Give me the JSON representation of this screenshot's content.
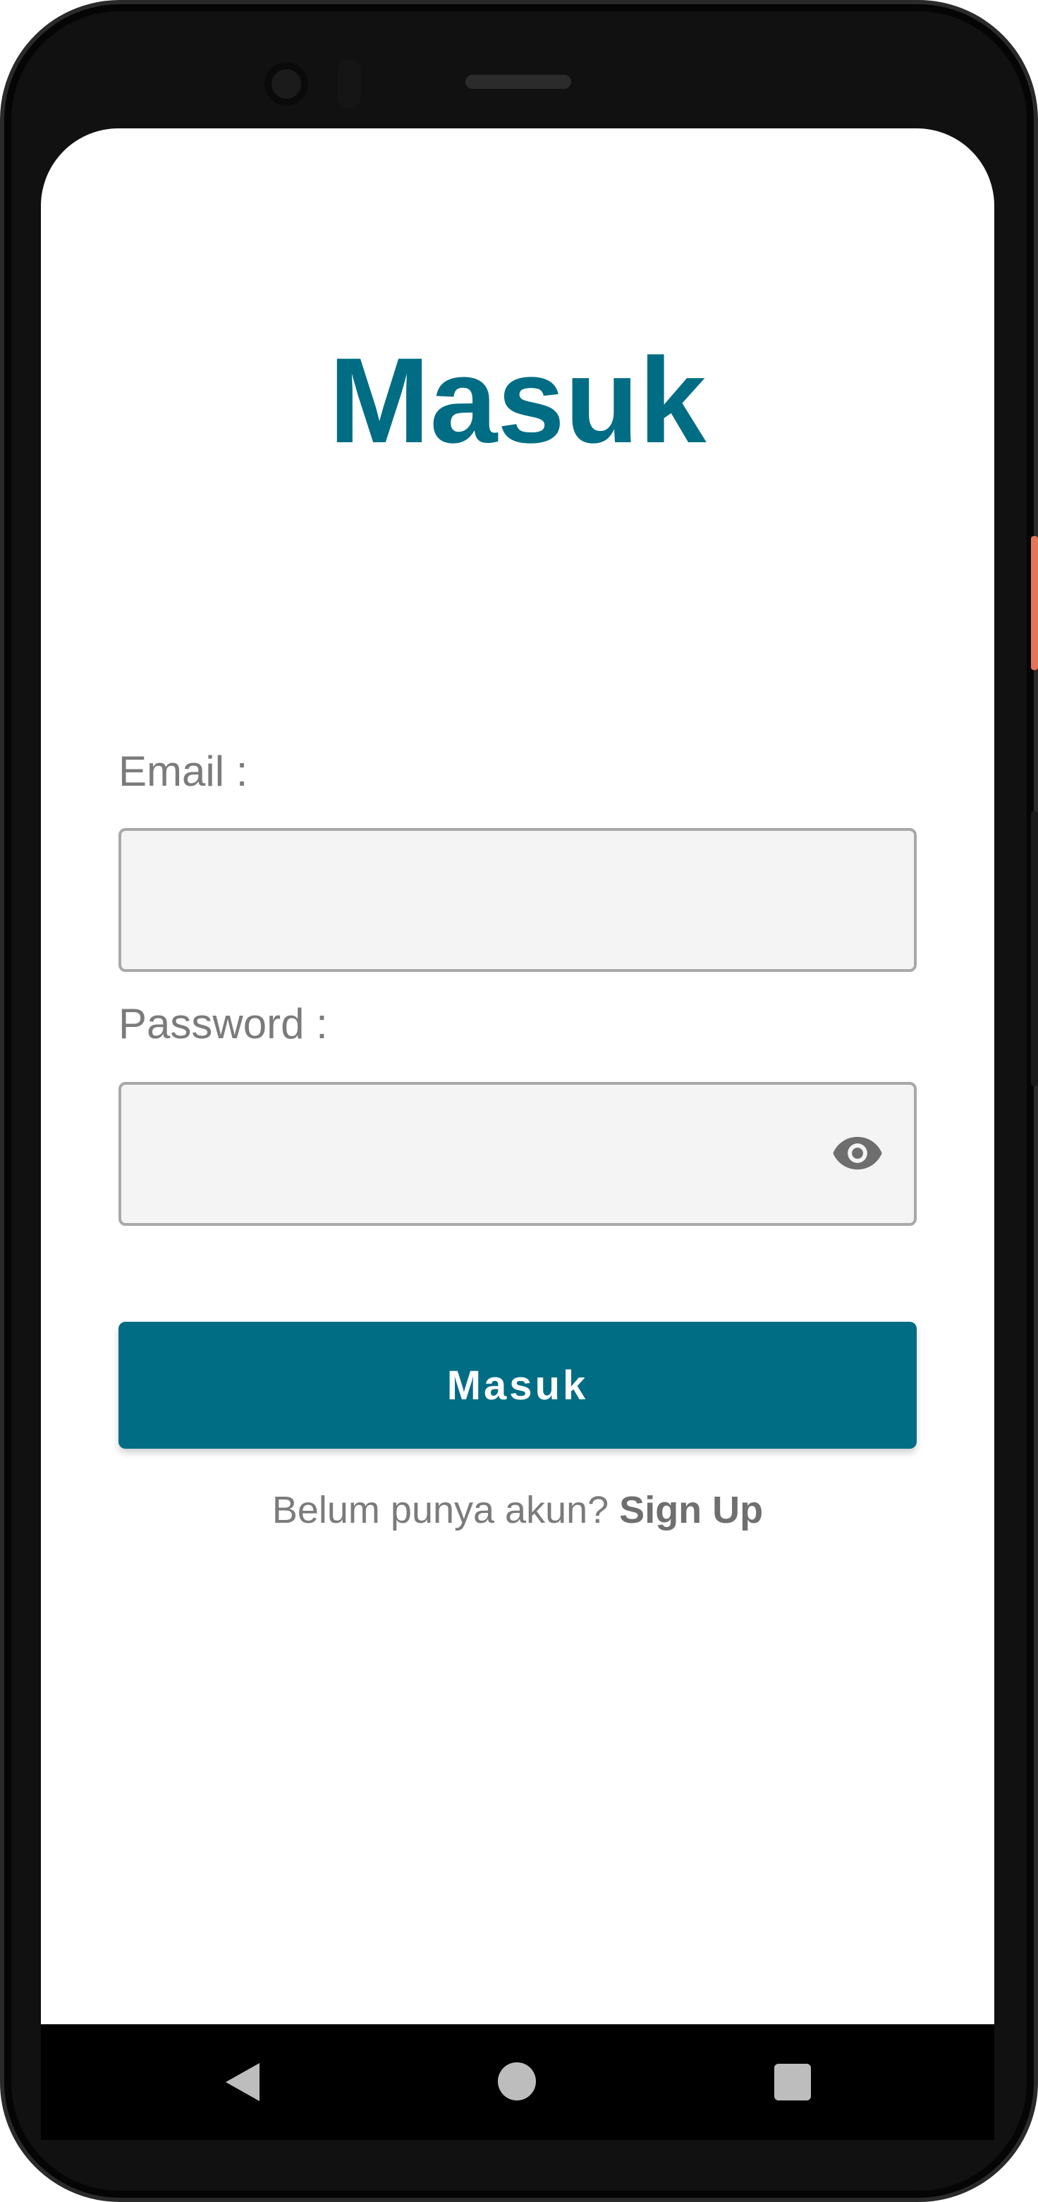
{
  "screen": {
    "title": "Masuk"
  },
  "form": {
    "email_label": "Email :",
    "email_value": "",
    "password_label": "Password :",
    "password_value": "",
    "password_visibility_icon": "eye-icon",
    "submit_label": "Masuk"
  },
  "footer": {
    "prompt": "Belum punya akun? ",
    "signup_link": "Sign Up"
  },
  "navbar": {
    "back_icon": "back-triangle-icon",
    "home_icon": "home-circle-icon",
    "recents_icon": "recents-square-icon"
  },
  "colors": {
    "accent": "#006d84",
    "label": "#7b7b7b",
    "input_bg": "#f4f4f4",
    "input_border": "#a8a8a8"
  }
}
